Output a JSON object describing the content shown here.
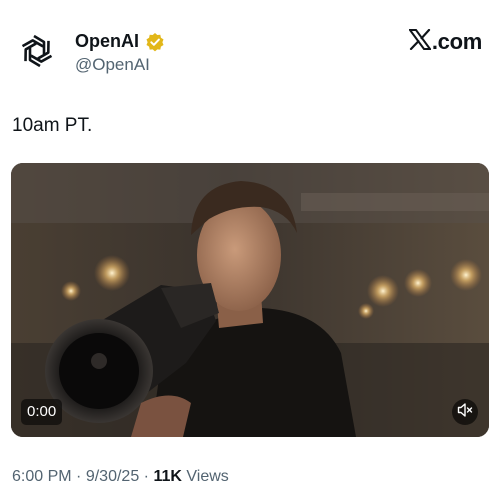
{
  "author": {
    "name": "OpenAI",
    "handle": "@OpenAI",
    "avatar_icon": "openai-logo-icon",
    "verified_icon": "gold-verified-badge-icon",
    "verified_color": "#e2b719"
  },
  "brand": {
    "logo_icon": "x-logo-icon",
    "suffix": ".com"
  },
  "tweet": {
    "text": "10am PT."
  },
  "media": {
    "type": "video",
    "time": "0:00",
    "mute_icon": "speaker-muted-icon"
  },
  "meta": {
    "time": "6:00 PM",
    "sep1": "·",
    "date": "9/30/25",
    "sep2": "·",
    "views_count": "11K",
    "views_label": "Views"
  },
  "colors": {
    "text_primary": "#0f1419",
    "text_secondary": "#536471"
  }
}
